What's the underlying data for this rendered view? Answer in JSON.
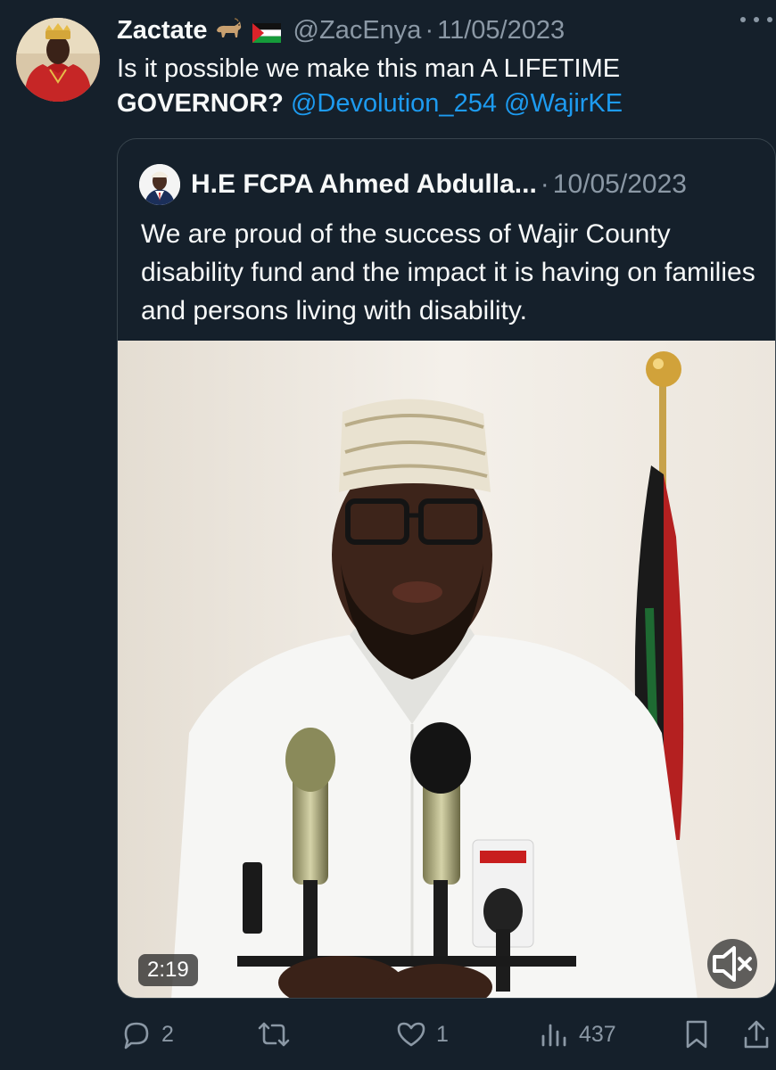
{
  "post": {
    "author": {
      "display_name": "Zactate",
      "emoji": [
        "goat",
        "palestine-flag"
      ],
      "handle": "@ZacEnya",
      "separator": "·",
      "date": "11/05/2023"
    },
    "text_plain": "Is it possible we make this man A LIFETIME",
    "text_bold": "GOVERNOR?",
    "mentions": [
      "@Devolution_254",
      "@WajirKE"
    ]
  },
  "quoted": {
    "author": {
      "display_name": "H.E FCPA Ahmed Abdulla...",
      "separator": "·",
      "date": "10/05/2023"
    },
    "text": "We are proud of the success of Wajir County disability fund and the impact it is having on families and persons living with disability.",
    "video": {
      "duration": "2:19",
      "muted": true
    }
  },
  "actions": {
    "replies": "2",
    "reposts": "",
    "likes": "1",
    "views": "437"
  },
  "colors": {
    "background": "#15202b",
    "text": "#f7f9f9",
    "muted": "#8b98a5",
    "link": "#1d9bf0",
    "border": "#38444d"
  }
}
